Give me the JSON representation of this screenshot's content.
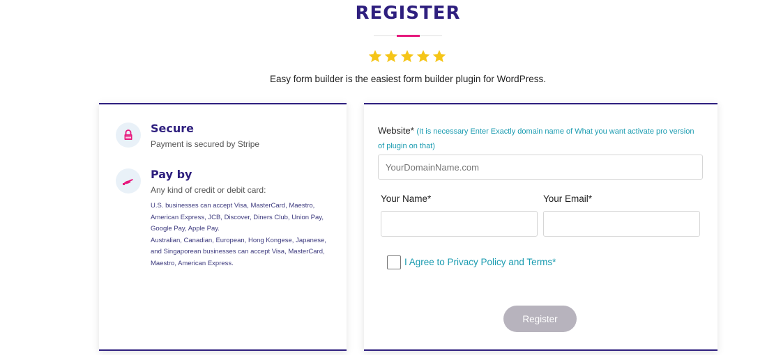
{
  "header": {
    "title": "REGISTER",
    "rating": 5,
    "subtitle": "Easy form builder is the easiest form builder plugin for WordPress."
  },
  "features": {
    "secure": {
      "icon": "lock-icon",
      "title": "Secure",
      "description": "Payment is secured by Stripe"
    },
    "pay": {
      "icon": "hand-card-icon",
      "title": "Pay by",
      "description": "Any kind of credit or debit card:",
      "details_1": "U.S. businesses can accept Visa, MasterCard, Maestro, American Express, JCB, Discover, Diners Club, Union Pay, Google Pay, Apple Pay.",
      "details_2": "Australian, Canadian, European, Hong Kongese, Japanese, and Singaporean businesses can accept Visa, MasterCard, Maestro, American Express."
    }
  },
  "form": {
    "website_label": "Website*",
    "website_note": "(It is necessary Enter Exactly domain name of What you want activate pro version of plugin on that)",
    "website_placeholder": "YourDomainName.com",
    "name_label": "Your Name*",
    "name_value": "",
    "email_label": "Your Email*",
    "email_value": "",
    "agree_text": "I Agree to Privacy Policy and Terms*",
    "agree_checked": false,
    "submit_label": "Register"
  },
  "colors": {
    "primary": "#2e1f7e",
    "accent": "#e6197d",
    "link": "#1a9bb0",
    "star": "#f5c518",
    "button_disabled": "#b7b3bd"
  }
}
